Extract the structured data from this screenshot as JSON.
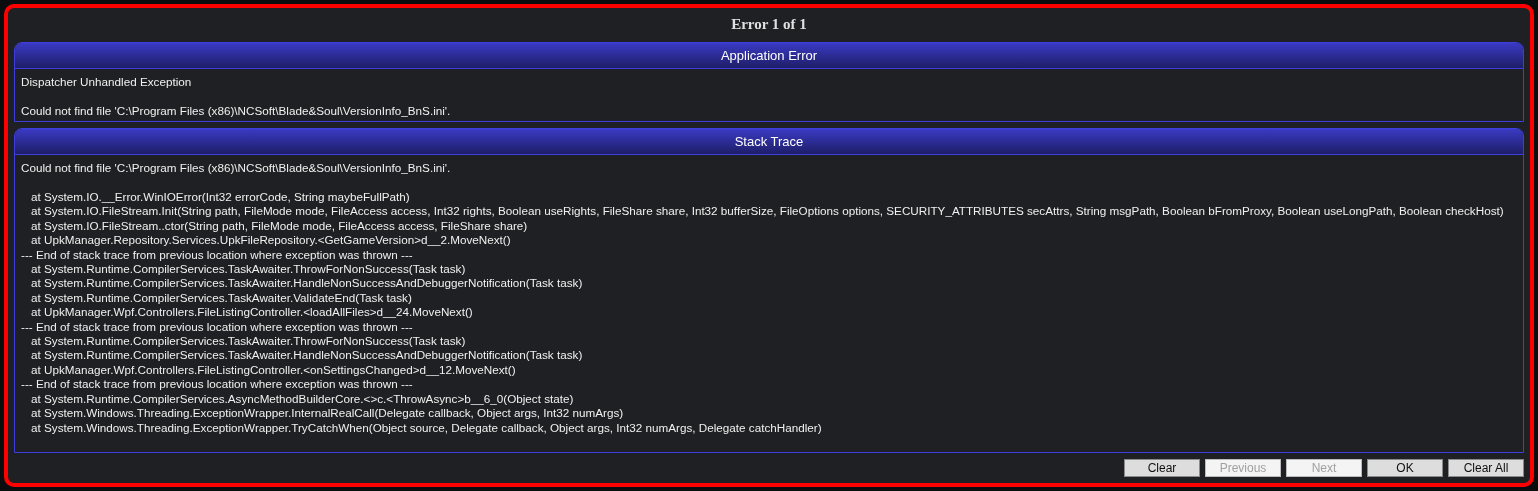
{
  "dialog": {
    "title": "Error 1 of 1"
  },
  "application_error": {
    "header": "Application Error",
    "lines": [
      "Dispatcher Unhandled Exception",
      "Could not find file 'C:\\Program Files (x86)\\NCSoft\\Blade&Soul\\VersionInfo_BnS.ini'."
    ]
  },
  "stack_trace": {
    "header": "Stack Trace",
    "message": "Could not find file 'C:\\Program Files (x86)\\NCSoft\\Blade&Soul\\VersionInfo_BnS.ini'.",
    "lines": [
      {
        "kind": "frame",
        "text": "at System.IO.__Error.WinIOError(Int32 errorCode, String maybeFullPath)"
      },
      {
        "kind": "frame",
        "text": "at System.IO.FileStream.Init(String path, FileMode mode, FileAccess access, Int32 rights, Boolean useRights, FileShare share, Int32 bufferSize, FileOptions options, SECURITY_ATTRIBUTES secAttrs, String msgPath, Boolean bFromProxy, Boolean useLongPath, Boolean checkHost)"
      },
      {
        "kind": "frame",
        "text": "at System.IO.FileStream..ctor(String path, FileMode mode, FileAccess access, FileShare share)"
      },
      {
        "kind": "frame",
        "text": "at UpkManager.Repository.Services.UpkFileRepository.<GetGameVersion>d__2.MoveNext()"
      },
      {
        "kind": "separator",
        "text": "--- End of stack trace from previous location where exception was thrown ---"
      },
      {
        "kind": "frame",
        "text": "at System.Runtime.CompilerServices.TaskAwaiter.ThrowForNonSuccess(Task task)"
      },
      {
        "kind": "frame",
        "text": "at System.Runtime.CompilerServices.TaskAwaiter.HandleNonSuccessAndDebuggerNotification(Task task)"
      },
      {
        "kind": "frame",
        "text": "at System.Runtime.CompilerServices.TaskAwaiter.ValidateEnd(Task task)"
      },
      {
        "kind": "frame",
        "text": "at UpkManager.Wpf.Controllers.FileListingController.<loadAllFiles>d__24.MoveNext()"
      },
      {
        "kind": "separator",
        "text": "--- End of stack trace from previous location where exception was thrown ---"
      },
      {
        "kind": "frame",
        "text": "at System.Runtime.CompilerServices.TaskAwaiter.ThrowForNonSuccess(Task task)"
      },
      {
        "kind": "frame",
        "text": "at System.Runtime.CompilerServices.TaskAwaiter.HandleNonSuccessAndDebuggerNotification(Task task)"
      },
      {
        "kind": "frame",
        "text": "at UpkManager.Wpf.Controllers.FileListingController.<onSettingsChanged>d__12.MoveNext()"
      },
      {
        "kind": "separator",
        "text": "--- End of stack trace from previous location where exception was thrown ---"
      },
      {
        "kind": "frame",
        "text": "at System.Runtime.CompilerServices.AsyncMethodBuilderCore.<>c.<ThrowAsync>b__6_0(Object state)"
      },
      {
        "kind": "frame",
        "text": "at System.Windows.Threading.ExceptionWrapper.InternalRealCall(Delegate callback, Object args, Int32 numArgs)"
      },
      {
        "kind": "frame",
        "text": "at System.Windows.Threading.ExceptionWrapper.TryCatchWhen(Object source, Delegate callback, Object args, Int32 numArgs, Delegate catchHandler)"
      }
    ]
  },
  "buttons": [
    {
      "label": "Clear",
      "disabled": false
    },
    {
      "label": "Previous",
      "disabled": true
    },
    {
      "label": "Next",
      "disabled": true
    },
    {
      "label": "OK",
      "disabled": false
    },
    {
      "label": "Clear All",
      "disabled": false
    }
  ]
}
